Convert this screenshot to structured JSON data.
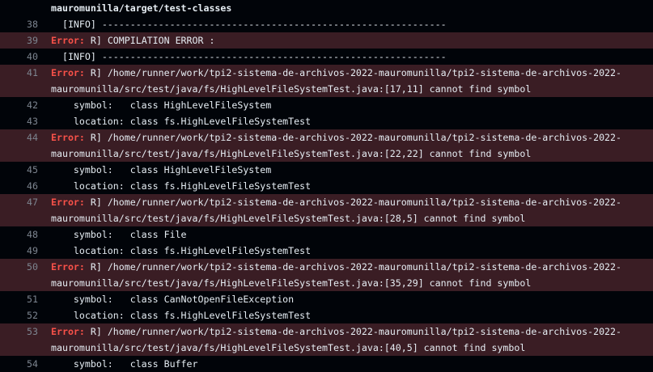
{
  "log": {
    "lines": [
      {
        "num": "",
        "error": false,
        "segments": [
          "mauromunilla/target/test-classes"
        ]
      },
      {
        "num": "38",
        "error": false,
        "segments": [
          "  [INFO] -------------------------------------------------------------"
        ]
      },
      {
        "num": "39",
        "error": true,
        "segments": [
          "R] COMPILATION ERROR :"
        ]
      },
      {
        "num": "40",
        "error": false,
        "segments": [
          "  [INFO] -------------------------------------------------------------"
        ]
      },
      {
        "num": "41",
        "error": true,
        "segments": [
          "R] /home/runner/work/tpi2-sistema-de-archivos-2022-mauromunilla/tpi2-sistema-de-archivos-2022-",
          "mauromunilla/src/test/java/fs/HighLevelFileSystemTest.java:[17,11] cannot find symbol"
        ]
      },
      {
        "num": "42",
        "error": false,
        "segments": [
          "    symbol:   class HighLevelFileSystem"
        ]
      },
      {
        "num": "43",
        "error": false,
        "segments": [
          "    location: class fs.HighLevelFileSystemTest"
        ]
      },
      {
        "num": "44",
        "error": true,
        "segments": [
          "R] /home/runner/work/tpi2-sistema-de-archivos-2022-mauromunilla/tpi2-sistema-de-archivos-2022-",
          "mauromunilla/src/test/java/fs/HighLevelFileSystemTest.java:[22,22] cannot find symbol"
        ]
      },
      {
        "num": "45",
        "error": false,
        "segments": [
          "    symbol:   class HighLevelFileSystem"
        ]
      },
      {
        "num": "46",
        "error": false,
        "segments": [
          "    location: class fs.HighLevelFileSystemTest"
        ]
      },
      {
        "num": "47",
        "error": true,
        "segments": [
          "R] /home/runner/work/tpi2-sistema-de-archivos-2022-mauromunilla/tpi2-sistema-de-archivos-2022-",
          "mauromunilla/src/test/java/fs/HighLevelFileSystemTest.java:[28,5] cannot find symbol"
        ]
      },
      {
        "num": "48",
        "error": false,
        "segments": [
          "    symbol:   class File"
        ]
      },
      {
        "num": "49",
        "error": false,
        "segments": [
          "    location: class fs.HighLevelFileSystemTest"
        ]
      },
      {
        "num": "50",
        "error": true,
        "segments": [
          "R] /home/runner/work/tpi2-sistema-de-archivos-2022-mauromunilla/tpi2-sistema-de-archivos-2022-",
          "mauromunilla/src/test/java/fs/HighLevelFileSystemTest.java:[35,29] cannot find symbol"
        ]
      },
      {
        "num": "51",
        "error": false,
        "segments": [
          "    symbol:   class CanNotOpenFileException"
        ]
      },
      {
        "num": "52",
        "error": false,
        "segments": [
          "    location: class fs.HighLevelFileSystemTest"
        ]
      },
      {
        "num": "53",
        "error": true,
        "segments": [
          "R] /home/runner/work/tpi2-sistema-de-archivos-2022-mauromunilla/tpi2-sistema-de-archivos-2022-",
          "mauromunilla/src/test/java/fs/HighLevelFileSystemTest.java:[40,5] cannot find symbol"
        ]
      },
      {
        "num": "54",
        "error": false,
        "segments": [
          "    symbol:   class Buffer"
        ]
      }
    ],
    "error_label": "Error:",
    "colors": {
      "background": "#010409",
      "error_row_bg": "#3a1d24",
      "error_label": "#f85149",
      "line_number": "#7d8590",
      "text": "#e6edf3"
    }
  }
}
